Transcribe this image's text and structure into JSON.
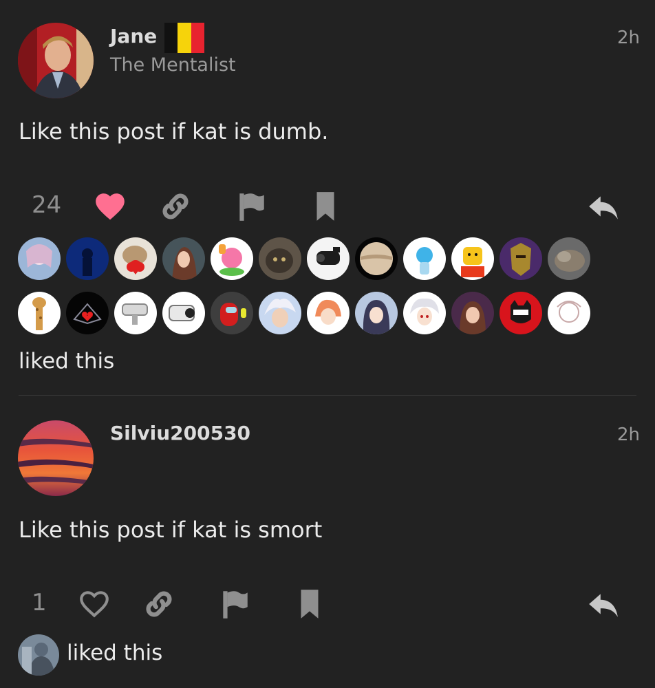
{
  "posts": [
    {
      "author": "Jane",
      "author_title": "The Mentalist",
      "time": "2h",
      "content": "Like this post if kat is dumb.",
      "like_count": "24",
      "liked": true,
      "liked_label": "liked this"
    },
    {
      "author": "Silviu200530",
      "time": "2h",
      "content": "Like this post if kat is smort",
      "like_count": "1",
      "liked": false,
      "liked_label": "liked this"
    }
  ],
  "colors": {
    "background": "#222222",
    "heart_liked": "#ff6f91",
    "icon_gray": "#8f8f8f",
    "flag_black": "#111111",
    "flag_yellow": "#f6d30b",
    "flag_red": "#e8232f"
  }
}
